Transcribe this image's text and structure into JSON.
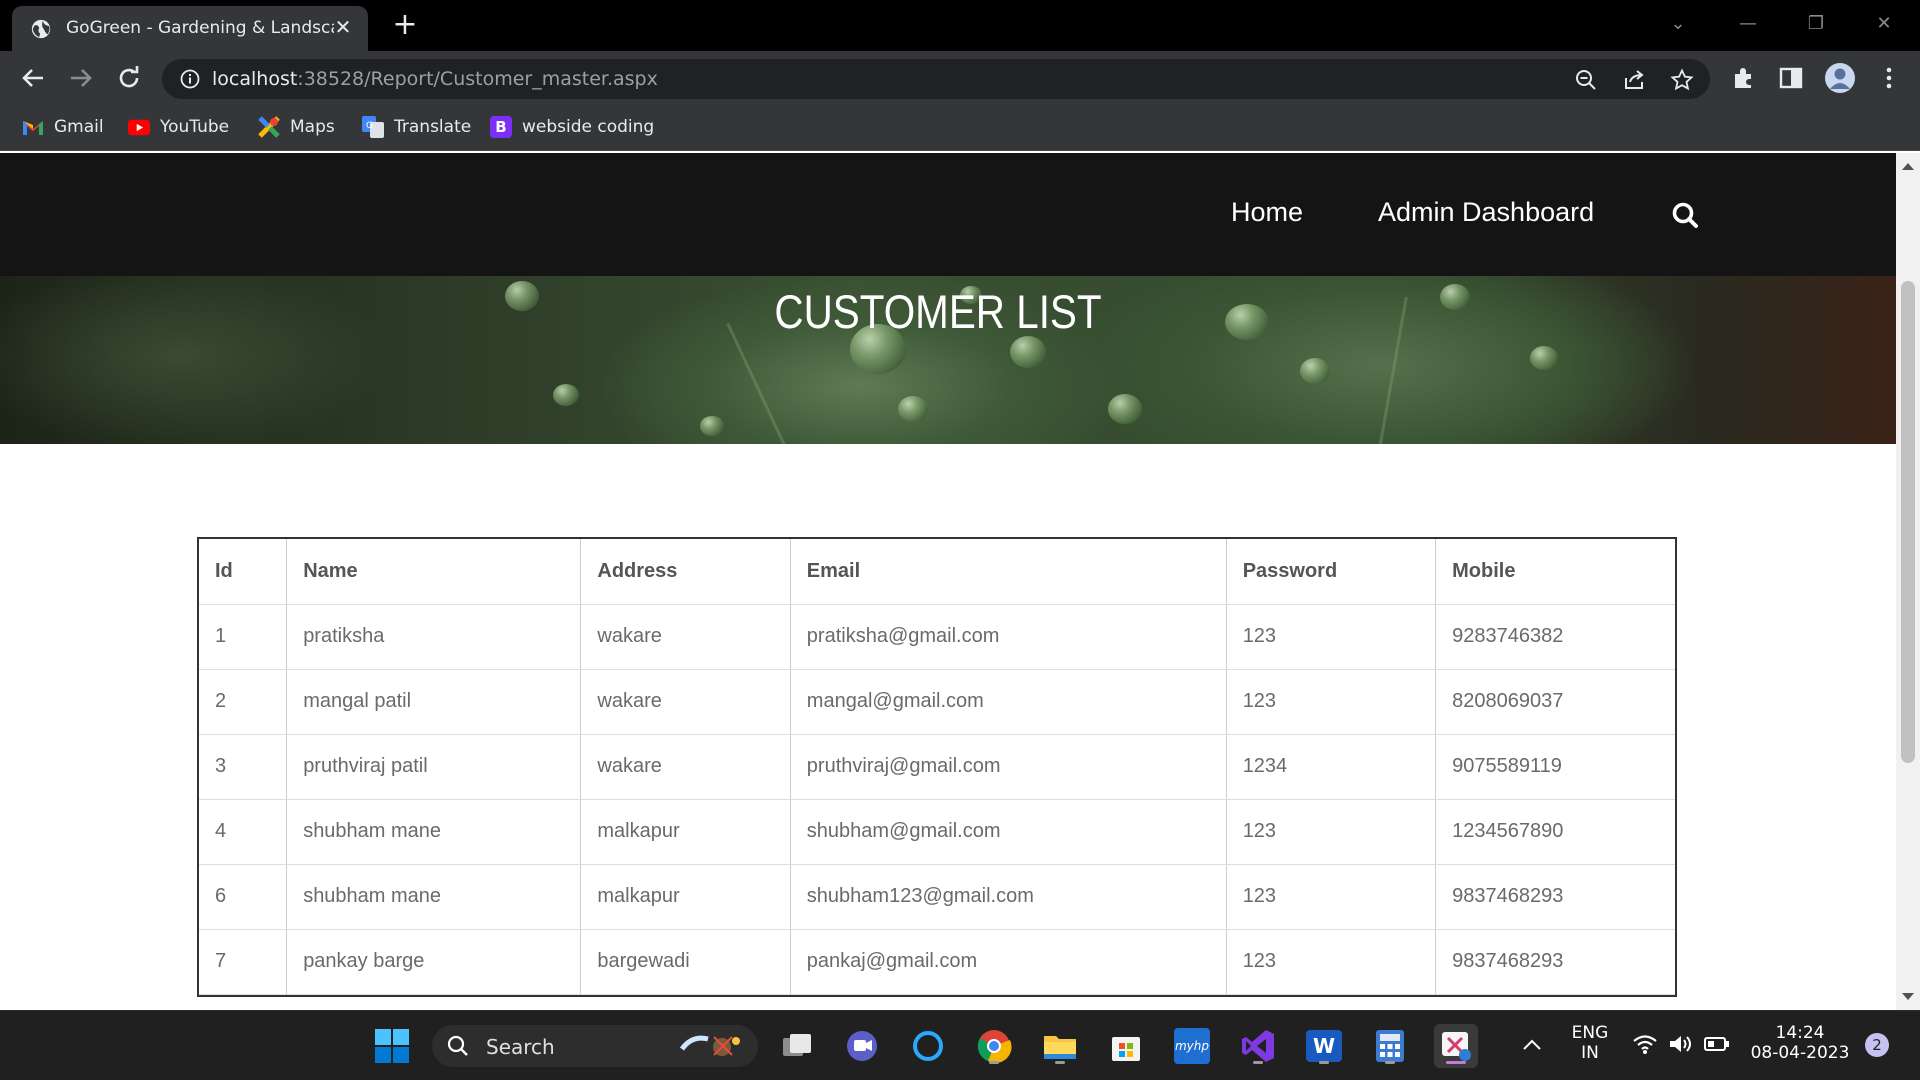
{
  "browser": {
    "tab_title": "GoGreen - Gardening & Landscap",
    "url_host": "localhost",
    "url_rest": ":38528/Report/Customer_master.aspx",
    "bookmarks": [
      {
        "label": "Gmail",
        "icon": "gmail-icon"
      },
      {
        "label": "YouTube",
        "icon": "youtube-icon"
      },
      {
        "label": "Maps",
        "icon": "maps-icon"
      },
      {
        "label": "Translate",
        "icon": "translate-icon"
      },
      {
        "label": "webside coding",
        "icon": "bootstrap-icon"
      }
    ]
  },
  "site": {
    "nav": {
      "home": "Home",
      "admin": "Admin Dashboard"
    },
    "hero_title": "CUSTOMER LIST"
  },
  "table": {
    "headers": [
      "Id",
      "Name",
      "Address",
      "Email",
      "Password",
      "Mobile"
    ],
    "rows": [
      [
        "1",
        "pratiksha",
        "wakare",
        "pratiksha@gmail.com",
        "123",
        "9283746382"
      ],
      [
        "2",
        "mangal patil",
        "wakare",
        "mangal@gmail.com",
        "123",
        "8208069037"
      ],
      [
        "3",
        "pruthviraj patil",
        "wakare",
        "pruthviraj@gmail.com",
        "1234",
        "9075589119"
      ],
      [
        "4",
        "shubham mane",
        "malkapur",
        "shubham@gmail.com",
        "123",
        "1234567890"
      ],
      [
        "6",
        "shubham mane",
        "malkapur",
        "shubham123@gmail.com",
        "123",
        "9837468293"
      ],
      [
        "7",
        "pankay barge",
        "bargewadi",
        "pankaj@gmail.com",
        "123",
        "9837468293"
      ]
    ]
  },
  "taskbar": {
    "search_label": "Search",
    "lang": "ENG",
    "region": "IN",
    "time": "14:24",
    "date": "08-04-2023",
    "notification_count": "2",
    "hp_label": "myhp",
    "word_label": "W",
    "bootstrap_letter": "B"
  },
  "colors": {
    "nav_bg": "#141414",
    "chrome_bg": "#35363a",
    "taskbar_bg": "#202020"
  }
}
